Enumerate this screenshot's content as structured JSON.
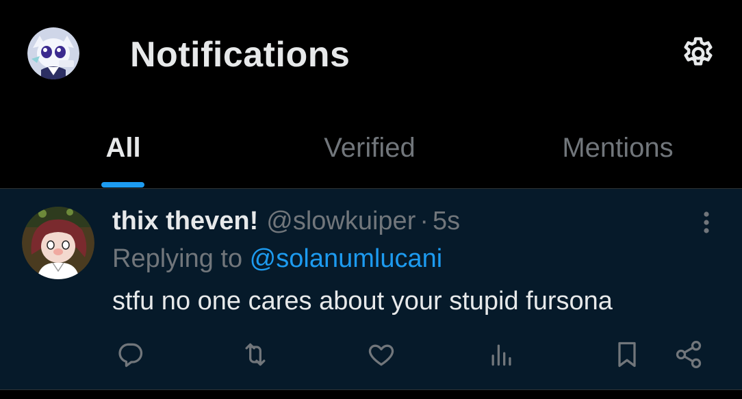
{
  "header": {
    "title": "Notifications",
    "avatar_icon": "user-avatar",
    "settings_icon": "gear-icon"
  },
  "tabs": [
    {
      "label": "All",
      "active": true
    },
    {
      "label": "Verified",
      "active": false
    },
    {
      "label": "Mentions",
      "active": false
    }
  ],
  "notification": {
    "display_name": "thix theven!",
    "handle": "@slowkuiper",
    "separator": "·",
    "timestamp": "5s",
    "replying_prefix": "Replying to ",
    "replying_to": "@solanumlucani",
    "text": "stfu no one cares about your stupid fursona",
    "actions": [
      "reply-icon",
      "retweet-icon",
      "like-icon",
      "views-icon",
      "bookmark-icon",
      "share-icon"
    ]
  },
  "colors": {
    "background": "#000000",
    "tweet_background": "#061a2a",
    "accent": "#1d9bf0",
    "text_primary": "#e7e9ea",
    "text_secondary": "#71767b",
    "divider": "#2f3336"
  }
}
